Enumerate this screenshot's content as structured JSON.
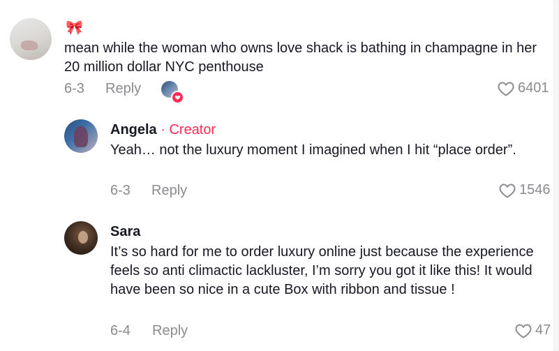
{
  "comments": [
    {
      "emoji": "🎀",
      "text": "mean while the woman who owns love shack is bathing in champagne in her 20 million dollar NYC penthouse",
      "date": "6-3",
      "reply_label": "Reply",
      "likes": "6401"
    },
    {
      "author": "Angela",
      "badge": " · Creator",
      "text": "Yeah… not the luxury moment I imagined when I hit “place order”.",
      "date": "6-3",
      "reply_label": "Reply",
      "likes": "1546"
    },
    {
      "author": "Sara",
      "text": "It’s so hard for me to order luxury online just because the experience feels so anti climactic lackluster, I’m sorry you got it like this! It would have been so nice in a cute Box with ribbon and tissue !",
      "date": "6-4",
      "reply_label": "Reply",
      "likes": "47"
    }
  ],
  "colors": {
    "accent": "#fe2c55",
    "muted": "#8a8b91",
    "text": "#161823"
  }
}
